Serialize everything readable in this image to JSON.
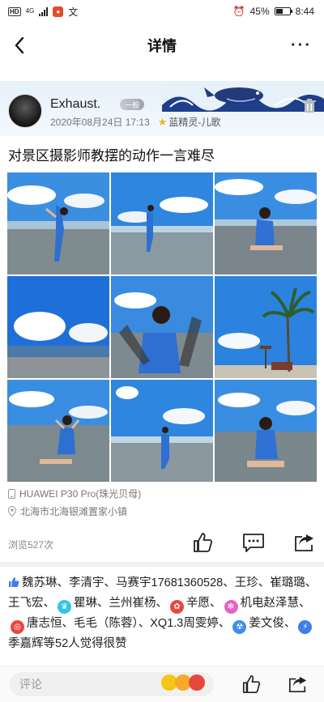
{
  "status_bar": {
    "hd": "HD",
    "network": "4G",
    "app": "文",
    "battery": "45%",
    "time": "8:44"
  },
  "nav": {
    "title": "详情",
    "back_icon": "chevron-left-icon",
    "more": "···"
  },
  "post": {
    "username": "Exhaust.",
    "level_badge": "一般",
    "date": "2020年08月24日 17:13",
    "tag": "蓝精灵-儿歌",
    "text": "对景区摄影师教摆的动作一言难尽",
    "device": "HUAWEI P30 Pro(珠光贝母)",
    "location": "北海市北海银滩置家小镇",
    "views": "浏览527次"
  },
  "likes": {
    "names": [
      "魏苏琳、",
      "李清宇、",
      "马赛宇17681360528、",
      "王珍、",
      "崔璐璐、",
      "王飞宏、",
      "瞿琳、",
      "兰州崔杨、",
      "辛愿、",
      "机电赵泽慧、",
      "唐志恒、",
      "毛毛（陈蓉）、",
      "XQ1.3周雯婷、",
      "姜文俊、",
      "季嘉辉等52人觉得很赞"
    ]
  },
  "bottom": {
    "comment_placeholder": "评论"
  },
  "colors": {
    "accent": "#3d7fe6",
    "header_bg": "#e6f1fa",
    "meta_text": "#777777"
  }
}
